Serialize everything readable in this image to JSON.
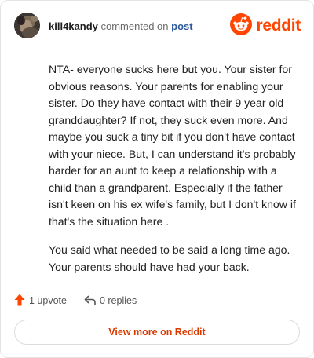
{
  "header": {
    "username": "kill4kandy",
    "action_text": "commented on",
    "post_link": "post",
    "brand_name": "reddit",
    "brand_color": "#ff4500",
    "avatar_icon": "avatar-icon",
    "logo_icon": "reddit-alien-icon"
  },
  "comment": {
    "paragraphs": [
      "NTA- everyone sucks here but you. Your sister for obvious reasons. Your parents for enabling your sister. Do they have contact with their 9 year old granddaughter? If not, they suck even more. And maybe you suck a tiny bit if you don't have contact with your niece. But, I can understand it's probably harder for an aunt to keep a relationship with a child than a grandparent. Especially if the father isn't keen on his ex wife's family, but I don't know if that's the situation here .",
      "You said what needed to be said a long time ago. Your parents should have had your back."
    ]
  },
  "actions": {
    "upvote_label": "1 upvote",
    "upvote_icon": "upvote-arrow-icon",
    "upvote_color": "#ff4500",
    "replies_label": "0 replies",
    "replies_icon": "reply-arrow-icon"
  },
  "footer": {
    "view_more_label": "View more on Reddit",
    "view_more_color": "#d93a00"
  }
}
